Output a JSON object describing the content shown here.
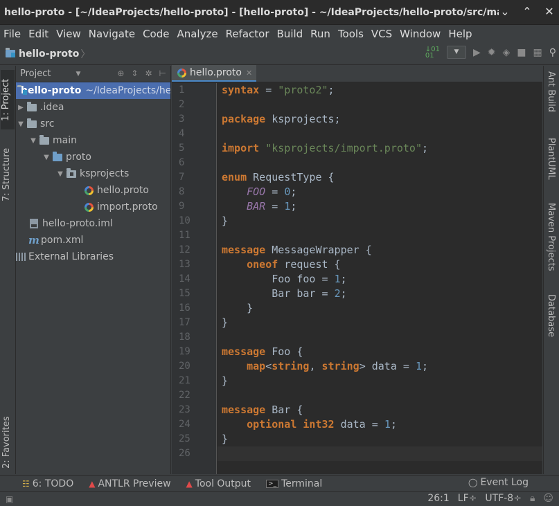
{
  "window": {
    "title": "hello-proto - [~/IdeaProjects/hello-proto] - [hello-proto] - ~/IdeaProjects/hello-proto/src/main/proto/k...",
    "controls": [
      "⌄",
      "⌃",
      "✕"
    ]
  },
  "menu": [
    "File",
    "Edit",
    "View",
    "Navigate",
    "Code",
    "Analyze",
    "Refactor",
    "Build",
    "Run",
    "Tools",
    "VCS",
    "Window",
    "Help"
  ],
  "navbar": {
    "breadcrumb": "hello-proto",
    "breadcrumb_sep": "〉"
  },
  "left_tabs": {
    "project": "1: Project",
    "structure": "7: Structure",
    "favorites": "2: Favorites"
  },
  "project_panel": {
    "header": "Project",
    "tree": [
      {
        "label": "hello-proto",
        "path": "~/IdeaProjects/he",
        "icon": "module-folder-icon",
        "depth": 0,
        "arrow": "▼",
        "selected": true
      },
      {
        "label": ".idea",
        "icon": "folder-icon",
        "depth": 0,
        "arrow": "▶"
      },
      {
        "label": "src",
        "icon": "folder-icon",
        "depth": 0,
        "arrow": "▼"
      },
      {
        "label": "main",
        "icon": "folder-icon",
        "depth": 1,
        "arrow": "▼"
      },
      {
        "label": "proto",
        "icon": "source-folder-icon",
        "depth": 2,
        "arrow": "▼"
      },
      {
        "label": "ksprojects",
        "icon": "package-icon",
        "depth": 3,
        "arrow": "▼"
      },
      {
        "label": "hello.proto",
        "icon": "proto-file-icon",
        "depth": 4,
        "arrow": ""
      },
      {
        "label": "import.proto",
        "icon": "proto-file-icon",
        "depth": 4,
        "arrow": ""
      },
      {
        "label": "hello-proto.iml",
        "icon": "iml-file-icon",
        "depth": 0,
        "arrow": ""
      },
      {
        "label": "pom.xml",
        "icon": "maven-icon",
        "depth": 0,
        "arrow": ""
      },
      {
        "label": "External Libraries",
        "icon": "libraries-icon",
        "depth": -1,
        "arrow": ""
      }
    ]
  },
  "editor": {
    "tab_label": "hello.proto",
    "current_line": 26,
    "line_numbers": [
      "1",
      "2",
      "3",
      "4",
      "5",
      "6",
      "7",
      "8",
      "9",
      "10",
      "11",
      "12",
      "13",
      "14",
      "15",
      "16",
      "17",
      "18",
      "19",
      "20",
      "21",
      "22",
      "23",
      "24",
      "25",
      "26"
    ]
  },
  "right_tabs": {
    "ant": "Ant Build",
    "plantuml": "PlantUML",
    "maven": "Maven Projects",
    "database": "Database"
  },
  "bottom_tabs": {
    "todo": "6: TODO",
    "antlr": "ANTLR Preview",
    "tool_output": "Tool Output",
    "terminal": "Terminal",
    "event_log": "Event Log"
  },
  "status": {
    "position": "26:1",
    "line_sep": "LF÷",
    "encoding": "UTF-8÷"
  }
}
